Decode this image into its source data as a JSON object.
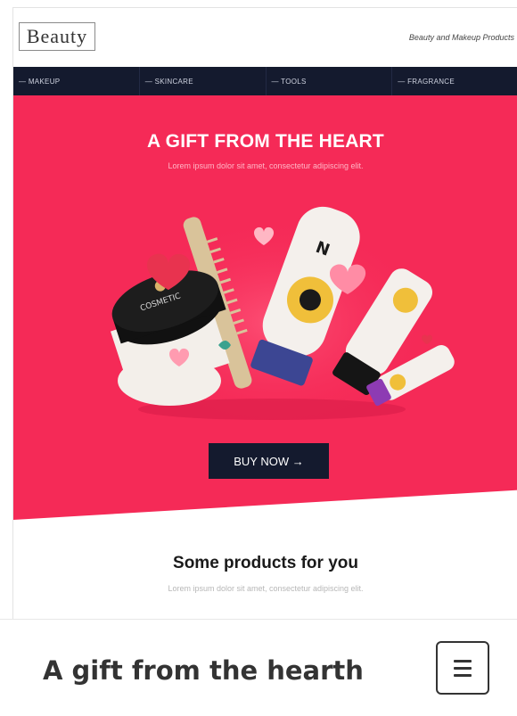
{
  "header": {
    "logo_text": "Beauty",
    "tagline": "Beauty and Makeup Products"
  },
  "nav": {
    "items": [
      {
        "label": "— MAKEUP"
      },
      {
        "label": "— SKINCARE"
      },
      {
        "label": "— TOOLS"
      },
      {
        "label": "— FRAGRANCE"
      }
    ]
  },
  "hero": {
    "title": "A GIFT FROM THE HEART",
    "subtitle": "Lorem ipsum dolor sit amet, consectetur adipiscing elit.",
    "button_label": "BUY NOW →",
    "jar_label": "COSMETIC",
    "tube_letter": "N",
    "background_color": "#f52a57"
  },
  "products": {
    "title": "Some products for you",
    "subtitle": "Lorem ipsum dolor sit amet, consectetur adipiscing elit."
  },
  "footer": {
    "title": "A gift from the hearth",
    "menu_icon": "hamburger-menu-icon"
  },
  "colors": {
    "accent": "#f52a57",
    "navy": "#141a2e"
  }
}
